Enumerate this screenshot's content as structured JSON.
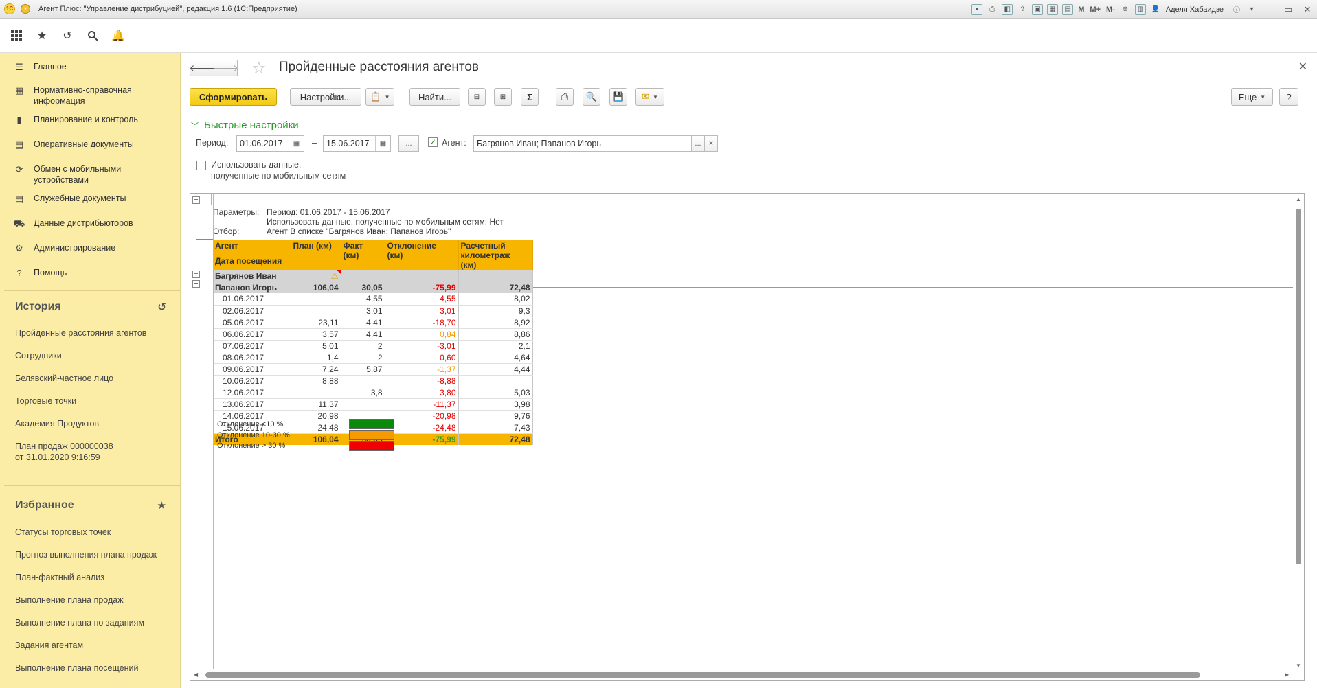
{
  "window": {
    "title": "Агент Плюс: \"Управление дистрибуцией\", редакция 1.6  (1С:Предприятие)",
    "user": "Аделя Хабаидзе",
    "mem_buttons": [
      "M",
      "M+",
      "M-"
    ]
  },
  "sidebar": {
    "nav": [
      {
        "icon": "menu-icon",
        "label": "Главное"
      },
      {
        "icon": "table-icon",
        "label": "Нормативно-справочная информация"
      },
      {
        "icon": "chart-icon",
        "label": "Планирование и контроль"
      },
      {
        "icon": "documents-icon",
        "label": "Оперативные документы"
      },
      {
        "icon": "sync-icon",
        "label": "Обмен с мобильными устройствами"
      },
      {
        "icon": "documents-icon",
        "label": "Служебные документы"
      },
      {
        "icon": "distributor-icon",
        "label": "Данные дистрибьюторов"
      },
      {
        "icon": "gear-icon",
        "label": "Администрирование"
      },
      {
        "icon": "help-icon",
        "label": "Помощь"
      }
    ],
    "history": {
      "title": "История",
      "items": [
        "Пройденные расстояния агентов",
        "Сотрудники",
        "Белявский-частное лицо",
        "Торговые точки",
        "Академия Продуктов",
        "План продаж 000000038 от 31.01.2020 9:16:59"
      ]
    },
    "favorites": {
      "title": "Избранное",
      "items": [
        "Статусы торговых точек",
        "Прогноз выполнения плана продаж",
        "План-фактный анализ",
        "Выполнение плана продаж",
        "Выполнение плана по заданиям",
        "Задания агентам",
        "Выполнение плана посещений"
      ]
    }
  },
  "page": {
    "title": "Пройденные расстояния агентов",
    "buttons": {
      "generate": "Сформировать",
      "settings": "Настройки...",
      "find": "Найти...",
      "more": "Еще",
      "help": "?"
    },
    "quick": {
      "title": "Быстрые настройки",
      "period_label": "Период:",
      "date_from": "01.06.2017",
      "dash": "–",
      "date_to": "15.06.2017",
      "ellipsis": "...",
      "agent_label": "Агент:",
      "agent_value": "Багрянов Иван; Папанов Игорь",
      "clear": "×",
      "mobile_line1": "Использовать данные,",
      "mobile_line2": "полученные по мобильным сетям"
    }
  },
  "report": {
    "params_label": "Параметры:",
    "params_lines": [
      "Период: 01.06.2017 - 15.06.2017",
      "Использовать данные, полученные по мобильным сетям: Нет",
      "Агент В списке \"Багрянов Иван; Папанов Игорь\""
    ],
    "filter_label": "Отбор:",
    "headers": {
      "agent": "Агент",
      "date": "Дата посещения",
      "plan": "План (км)",
      "fact": "Факт (км)",
      "dev": "Отклонение (км)",
      "calc": "Расчетный километраж (км)"
    },
    "groups": [
      {
        "name": "Багрянов Иван",
        "plan": "",
        "fact": "",
        "dev": "",
        "calc": "",
        "warning": true
      },
      {
        "name": "Папанов Игорь",
        "plan": "106,04",
        "fact": "30,05",
        "dev": "-75,99",
        "calc": "72,48"
      }
    ],
    "rows": [
      {
        "date": "01.06.2017",
        "plan": "",
        "fact": "4,55",
        "dev": "4,55",
        "dev_color": "red",
        "calc": "8,02"
      },
      {
        "date": "02.06.2017",
        "plan": "",
        "fact": "3,01",
        "dev": "3,01",
        "dev_color": "red",
        "calc": "9,3"
      },
      {
        "date": "05.06.2017",
        "plan": "23,11",
        "fact": "4,41",
        "dev": "-18,70",
        "dev_color": "red",
        "calc": "8,92"
      },
      {
        "date": "06.06.2017",
        "plan": "3,57",
        "fact": "4,41",
        "dev": "0,84",
        "dev_color": "orange",
        "calc": "8,86"
      },
      {
        "date": "07.06.2017",
        "plan": "5,01",
        "fact": "2",
        "dev": "-3,01",
        "dev_color": "red",
        "calc": "2,1"
      },
      {
        "date": "08.06.2017",
        "plan": "1,4",
        "fact": "2",
        "dev": "0,60",
        "dev_color": "red",
        "calc": "4,64"
      },
      {
        "date": "09.06.2017",
        "plan": "7,24",
        "fact": "5,87",
        "dev": "-1,37",
        "dev_color": "orange",
        "calc": "4,44"
      },
      {
        "date": "10.06.2017",
        "plan": "8,88",
        "fact": "",
        "dev": "-8,88",
        "dev_color": "red",
        "calc": ""
      },
      {
        "date": "12.06.2017",
        "plan": "",
        "fact": "3,8",
        "dev": "3,80",
        "dev_color": "red",
        "calc": "5,03"
      },
      {
        "date": "13.06.2017",
        "plan": "11,37",
        "fact": "",
        "dev": "-11,37",
        "dev_color": "red",
        "calc": "3,98"
      },
      {
        "date": "14.06.2017",
        "plan": "20,98",
        "fact": "",
        "dev": "-20,98",
        "dev_color": "red",
        "calc": "9,76"
      },
      {
        "date": "15.06.2017",
        "plan": "24,48",
        "fact": "",
        "dev": "-24,48",
        "dev_color": "red",
        "calc": "7,43"
      }
    ],
    "total": {
      "label": "Итого",
      "plan": "106,04",
      "fact": "30,05",
      "dev": "-75,99",
      "calc": "72,48"
    },
    "legend": [
      {
        "label": "Отклонение <10 %",
        "color": "#0a8a0a"
      },
      {
        "label": "Отклонение 10-30 %",
        "color": "#f59a00"
      },
      {
        "label": "Отклонение > 30 %",
        "color": "#f00000"
      }
    ]
  },
  "colors": {
    "sidebar_bg": "#fbeca6",
    "primary_btn": "#f5d22a",
    "header_orange": "#f7b500",
    "group_gray": "#d4d4d4",
    "quick_green": "#2a9a2a"
  }
}
